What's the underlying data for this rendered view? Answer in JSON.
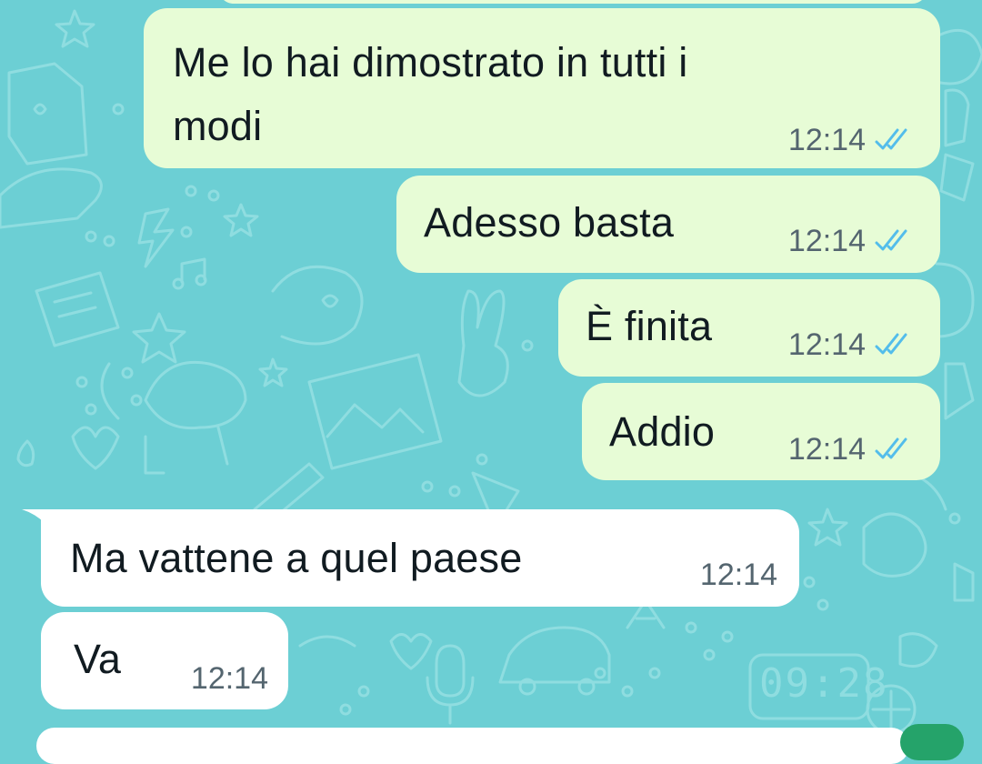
{
  "theme": {
    "wallpaper_color": "#6ccfd4",
    "outgoing_bubble_color": "#e7fcd6",
    "incoming_bubble_color": "#ffffff",
    "read_tick_color": "#53bdeb",
    "time_color": "#54656f"
  },
  "messages": [
    {
      "direction": "outgoing",
      "text_line1": "Me lo hai dimostrato in tutti i",
      "text_line2": "modi",
      "time": "12:14",
      "status": "read-double-check-icon"
    },
    {
      "direction": "outgoing",
      "text": "Adesso basta",
      "time": "12:14",
      "status": "read-double-check-icon"
    },
    {
      "direction": "outgoing",
      "text": "È finita",
      "time": "12:14",
      "status": "read-double-check-icon"
    },
    {
      "direction": "outgoing",
      "text": "Addio",
      "time": "12:14",
      "status": "read-double-check-icon"
    },
    {
      "direction": "incoming",
      "text": "Ma vattene a quel paese",
      "time": "12:14"
    },
    {
      "direction": "incoming",
      "text": "Va",
      "time": "12:14"
    }
  ],
  "wallpaper_clock": "09:28"
}
